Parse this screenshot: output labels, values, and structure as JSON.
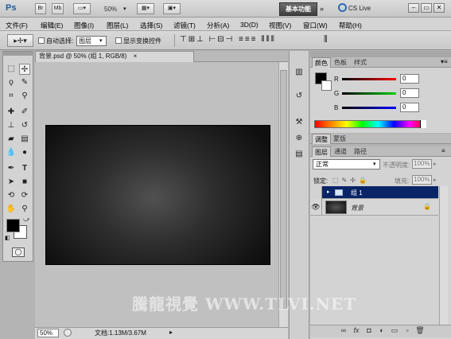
{
  "app": {
    "logo": "Ps",
    "br_label": "Br",
    "mb_label": "Mb",
    "zoom": "50%",
    "workspace": "基本功能",
    "cslive": "CS Live"
  },
  "menu": [
    "文件(F)",
    "编辑(E)",
    "图像(I)",
    "图层(L)",
    "选择(S)",
    "滤镜(T)",
    "分析(A)",
    "3D(D)",
    "视图(V)",
    "窗口(W)",
    "帮助(H)"
  ],
  "options": {
    "auto_select": "自动选择:",
    "layer_choice": "图层",
    "show_transform": "显示变换控件"
  },
  "document": {
    "tab_title": "背景.psd @ 50% (组 1, RGB/8)",
    "zoom_field": "50%",
    "doc_info": "文档:1.13M/3.67M"
  },
  "color_panel": {
    "tabs": [
      "颜色",
      "色板",
      "样式"
    ],
    "channels": [
      {
        "label": "R",
        "value": "0"
      },
      {
        "label": "G",
        "value": "0"
      },
      {
        "label": "B",
        "value": "0"
      }
    ]
  },
  "adjust_tabs": [
    "调整",
    "蒙版"
  ],
  "layers_panel": {
    "tabs": [
      "图层",
      "通道",
      "路径"
    ],
    "blend_mode": "正常",
    "opacity_label": "不透明度:",
    "opacity_value": "100%",
    "lock_label": "锁定:",
    "fill_label": "填充:",
    "fill_value": "100%",
    "layers": [
      {
        "name": "组 1"
      },
      {
        "name": "背景"
      }
    ]
  },
  "watermark": "騰龍視覺 WWW.TLVI.NET",
  "colors": {
    "selected_layer": "#0a2468",
    "workspace_button": "#4a4a4a"
  }
}
